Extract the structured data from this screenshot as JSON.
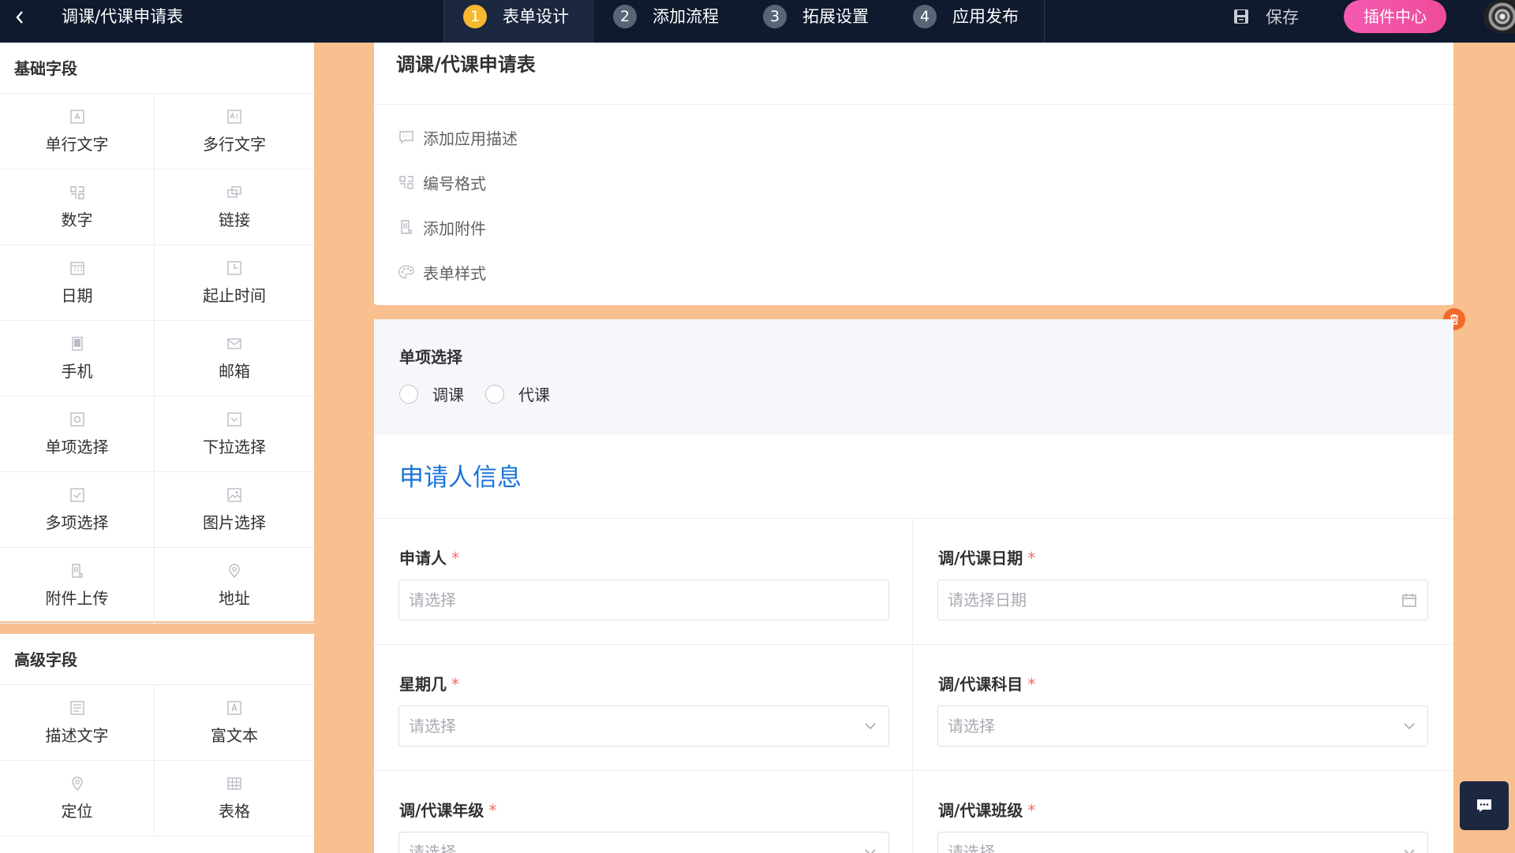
{
  "header": {
    "back_icon": "chevron-left-icon",
    "title": "调课/代课申请表",
    "steps": [
      {
        "num": "1",
        "label": "表单设计",
        "active": true
      },
      {
        "num": "2",
        "label": "添加流程",
        "active": false
      },
      {
        "num": "3",
        "label": "拓展设置",
        "active": false
      },
      {
        "num": "4",
        "label": "应用发布",
        "active": false
      }
    ],
    "save_label": "保存",
    "plugin_label": "插件中心"
  },
  "sidebar": {
    "basic_title": "基础字段",
    "basic_items": [
      {
        "label": "单行文字",
        "icon": "text-field-icon"
      },
      {
        "label": "多行文字",
        "icon": "textarea-icon"
      },
      {
        "label": "数字",
        "icon": "number-icon"
      },
      {
        "label": "链接",
        "icon": "link-icon"
      },
      {
        "label": "日期",
        "icon": "calendar-icon"
      },
      {
        "label": "起止时间",
        "icon": "clock-icon"
      },
      {
        "label": "手机",
        "icon": "phone-icon"
      },
      {
        "label": "邮箱",
        "icon": "mail-icon"
      },
      {
        "label": "单项选择",
        "icon": "radio-icon"
      },
      {
        "label": "下拉选择",
        "icon": "dropdown-icon"
      },
      {
        "label": "多项选择",
        "icon": "checkbox-icon"
      },
      {
        "label": "图片选择",
        "icon": "image-icon"
      },
      {
        "label": "附件上传",
        "icon": "attachment-icon"
      },
      {
        "label": "地址",
        "icon": "location-pin-icon"
      }
    ],
    "advanced_title": "高级字段",
    "advanced_items": [
      {
        "label": "描述文字",
        "icon": "description-icon"
      },
      {
        "label": "富文本",
        "icon": "rich-text-icon"
      },
      {
        "label": "定位",
        "icon": "location-icon"
      },
      {
        "label": "表格",
        "icon": "table-icon"
      }
    ]
  },
  "form": {
    "title": "调课/代课申请表",
    "options": [
      {
        "label": "添加应用描述",
        "icon": "comment-icon"
      },
      {
        "label": "编号格式",
        "icon": "number-format-icon"
      },
      {
        "label": "添加附件",
        "icon": "attachment-icon"
      },
      {
        "label": "表单样式",
        "icon": "palette-icon"
      }
    ],
    "radio_field": {
      "label": "单项选择",
      "options": [
        "调课",
        "代课"
      ]
    },
    "section_title": "申请人信息",
    "fields": [
      {
        "label": "申请人",
        "placeholder": "请选择",
        "suffix": ""
      },
      {
        "label": "调/代课日期",
        "placeholder": "请选择日期",
        "suffix": "calendar-icon"
      },
      {
        "label": "星期几",
        "placeholder": "请选择",
        "suffix": "chevron-down-icon"
      },
      {
        "label": "调/代课科目",
        "placeholder": "请选择",
        "suffix": "chevron-down-icon"
      },
      {
        "label": "调/代课年级",
        "placeholder": "请选择",
        "suffix": "chevron-down-icon"
      },
      {
        "label": "调/代课班级",
        "placeholder": "请选择",
        "suffix": "chevron-down-icon"
      }
    ],
    "required_mark": "*"
  },
  "colors": {
    "topbar": "#0f1a2e",
    "accent": "#f5b82e",
    "plugin": "#ee4c9a",
    "canvas": "#f7c08e",
    "section": "#1a73d8",
    "delete": "#f2692a"
  }
}
